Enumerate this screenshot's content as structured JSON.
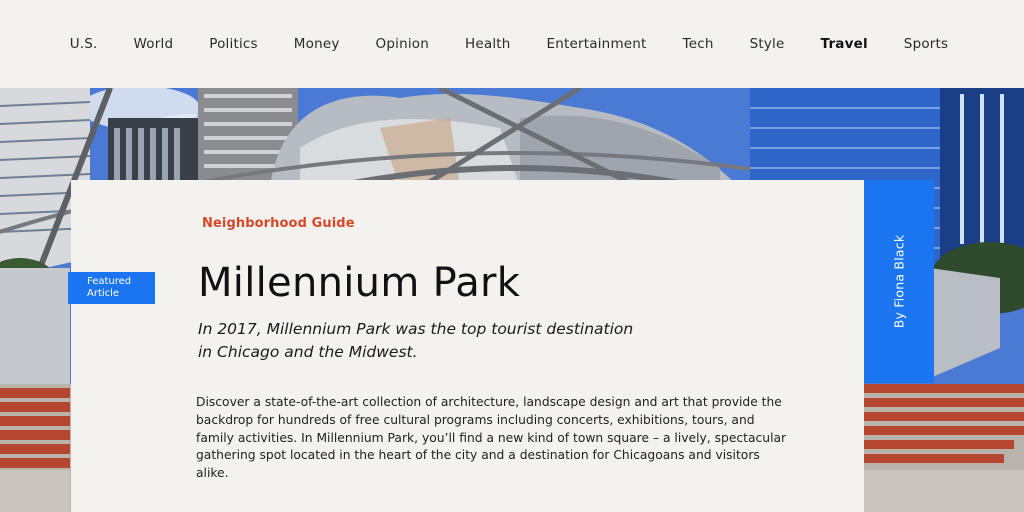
{
  "nav": {
    "items": [
      {
        "label": "U.S.",
        "active": false
      },
      {
        "label": "World",
        "active": false
      },
      {
        "label": "Politics",
        "active": false
      },
      {
        "label": "Money",
        "active": false
      },
      {
        "label": "Opinion",
        "active": false
      },
      {
        "label": "Health",
        "active": false
      },
      {
        "label": "Entertainment",
        "active": false
      },
      {
        "label": "Tech",
        "active": false
      },
      {
        "label": "Style",
        "active": false
      },
      {
        "label": "Travel",
        "active": true
      },
      {
        "label": "Sports",
        "active": false
      }
    ]
  },
  "article": {
    "kicker": "Neighborhood Guide",
    "title": "Millennium Park",
    "subtitle_line1": "In 2017, Millennium Park was the top tourist destination",
    "subtitle_line2": "in Chicago and the Midwest.",
    "body": "Discover a state-of-the-art collection of architecture, landscape design and art that provide the backdrop for hundreds of free cultural programs including concerts, exhibitions, tours, and family activities. In Millennium Park, you’ll find a new kind of town square – a lively, spectacular gathering spot located in the heart of the city and a destination for Chicagoans and visitors alike."
  },
  "badge": {
    "line1": "Featured",
    "line2": "Article"
  },
  "author": {
    "byline": "By Fiona Black"
  },
  "colors": {
    "accent_blue": "#1b74f0",
    "kicker_red": "#d9472b",
    "background": "#f3f2ee"
  }
}
